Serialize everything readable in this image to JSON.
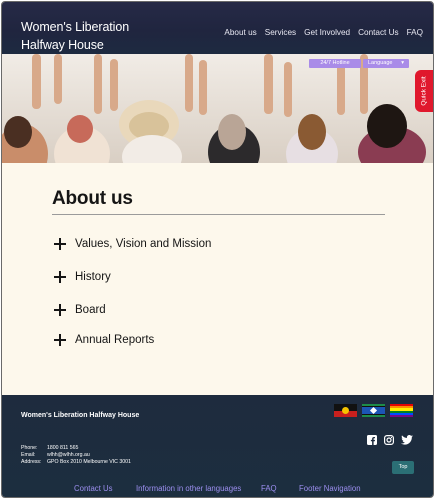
{
  "header": {
    "logo_line1": "Women's Liberation",
    "logo_line2": "Halfway House",
    "nav": [
      "About us",
      "Services",
      "Get Involved",
      "Contact Us",
      "FAQ"
    ]
  },
  "hero": {
    "hotline_label": "24/7 Hotline",
    "language_label": "Language",
    "quick_exit_label": "Quick Exit"
  },
  "main": {
    "title": "About us",
    "accordion": [
      "Values, Vision and Mission",
      "History",
      "Board",
      "Annual Reports"
    ]
  },
  "footer": {
    "org_name": "Women's Liberation Halfway House",
    "contact": [
      {
        "key": "Phone:",
        "value": "1800 811 565"
      },
      {
        "key": "Email:",
        "value": "wlhh@wlhh.org.au"
      },
      {
        "key": "Address:",
        "value": "GPO Box 2010 Melbourne VIC 3001"
      }
    ],
    "top_label": "Top",
    "links": [
      "Contact Us",
      "Information in other languages",
      "FAQ",
      "Footer Navigation"
    ],
    "flags": [
      "aboriginal-flag-icon",
      "torres-strait-flag-icon",
      "pride-flag-icon"
    ],
    "socials": [
      "facebook-icon",
      "instagram-icon",
      "twitter-icon"
    ]
  },
  "colors": {
    "header_bg": "#20253f",
    "accent_purple": "#a98be8",
    "quick_exit_red": "#e0182d",
    "page_bg": "#fdf8ec",
    "footer_bg": "#1e2b3e",
    "link_purple": "#9c8ff0",
    "top_button": "#2b6f75"
  }
}
